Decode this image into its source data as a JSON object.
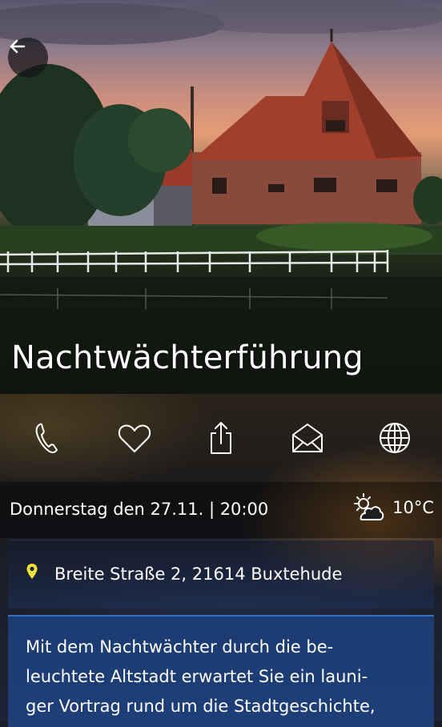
{
  "event": {
    "title": "Nachtwächterführung",
    "date_time": "Donnerstag den 27.11. | 20:00",
    "weather": {
      "icon": "partly-cloudy-icon",
      "temperature": "10°C"
    },
    "address": "Breite Straße 2, 21614 Buxtehude",
    "description_lines": [
      "Mit dem Nachtwächter durch die be-",
      "leuchtete Altstadt erwartet Sie ein launi-",
      "ger Vortrag rund um die Stadtgeschichte,"
    ]
  },
  "actions": [
    {
      "name": "call",
      "icon": "phone-icon"
    },
    {
      "name": "favorite",
      "icon": "heart-icon"
    },
    {
      "name": "share",
      "icon": "share-icon"
    },
    {
      "name": "email",
      "icon": "envelope-icon"
    },
    {
      "name": "website",
      "icon": "globe-icon"
    }
  ],
  "colors": {
    "pin": "#f0e23c",
    "description_bg": "#1e3e78",
    "text": "#ffffff"
  }
}
